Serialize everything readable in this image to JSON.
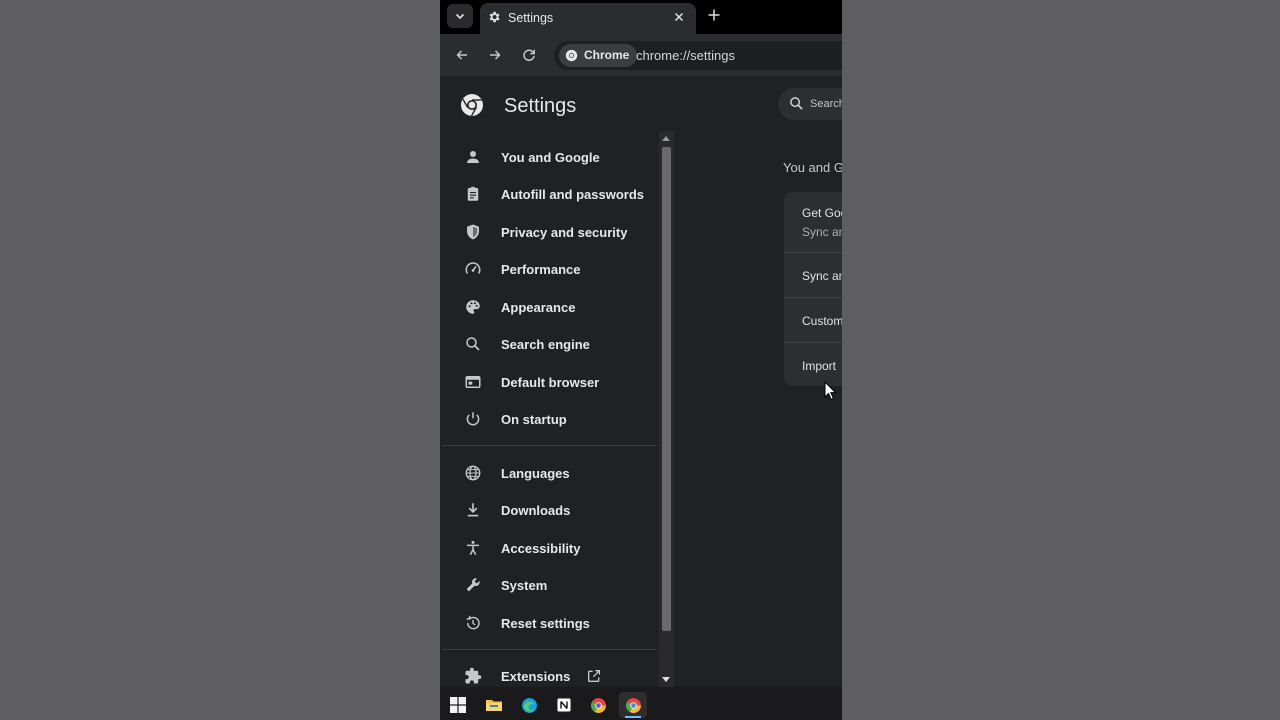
{
  "browser": {
    "tab": {
      "title": "Settings"
    },
    "chip_label": "Chrome",
    "url": "chrome://settings"
  },
  "settings": {
    "title": "Settings",
    "search_placeholder": "Search",
    "sidebar": {
      "items": [
        {
          "label": "You and Google",
          "icon": "person-icon"
        },
        {
          "label": "Autofill and passwords",
          "icon": "clipboard-icon"
        },
        {
          "label": "Privacy and security",
          "icon": "shield-icon"
        },
        {
          "label": "Performance",
          "icon": "speedometer-icon"
        },
        {
          "label": "Appearance",
          "icon": "palette-icon"
        },
        {
          "label": "Search engine",
          "icon": "search-icon"
        },
        {
          "label": "Default browser",
          "icon": "browser-window-icon"
        },
        {
          "label": "On startup",
          "icon": "power-icon"
        }
      ],
      "items2": [
        {
          "label": "Languages",
          "icon": "globe-icon"
        },
        {
          "label": "Downloads",
          "icon": "download-icon"
        },
        {
          "label": "Accessibility",
          "icon": "accessibility-icon"
        },
        {
          "label": "System",
          "icon": "wrench-icon"
        },
        {
          "label": "Reset settings",
          "icon": "history-icon"
        }
      ],
      "extensions": {
        "label": "Extensions",
        "icon": "puzzle-icon"
      }
    },
    "main": {
      "section_title": "You and G",
      "rows": [
        {
          "title": "Get Goo",
          "subtitle": "Sync an"
        },
        {
          "title": "Sync an"
        },
        {
          "title": "Custom"
        },
        {
          "title": "Import"
        }
      ]
    }
  },
  "colors": {
    "background": "#202124",
    "surface": "#2d2e31",
    "text": "#e3e3e3",
    "accent": "#7ab8ff"
  }
}
